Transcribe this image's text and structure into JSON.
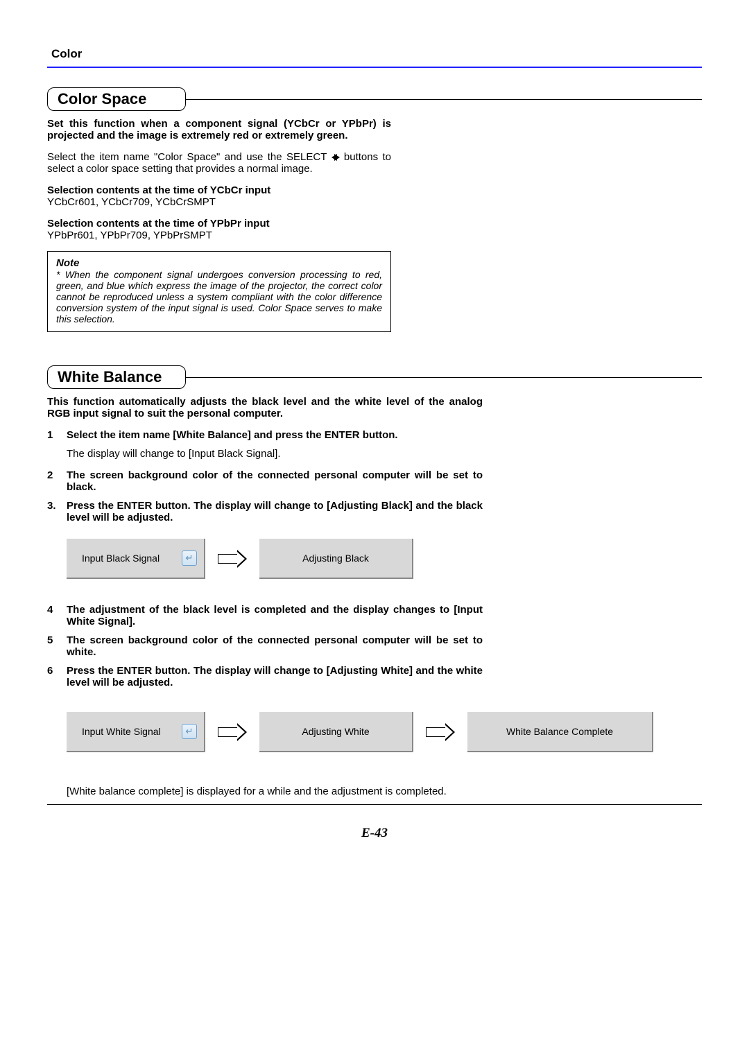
{
  "header": {
    "label": "Color"
  },
  "section1": {
    "title": "Color Space",
    "intro_bold": "Set this function when a component signal (YCbCr or YPbPr) is projected and the image is extremely red or extremely green.",
    "body_pre": "Select the item name \"Color Space\" and use the SELECT ",
    "body_post": " buttons to select a color space setting that provides a normal image.",
    "sub1_label": "Selection contents at the time of YCbCr input",
    "sub1_values": "YCbCr601, YCbCr709, YCbCrSMPT",
    "sub2_label": "Selection contents at the time of YPbPr input",
    "sub2_values": "YPbPr601, YPbPr709, YPbPrSMPT",
    "note_title": "Note",
    "note_body": "* When the component signal undergoes conversion processing to red, green, and blue which express the image of the projector, the correct color cannot be reproduced unless a system compliant with the color difference conversion system of the input signal is used. Color Space serves to make this selection."
  },
  "section2": {
    "title": "White Balance",
    "intro_bold": "This function automatically adjusts the black level and the white level of the analog RGB input signal to suit the personal computer.",
    "steps": [
      {
        "n": "1",
        "bold": "Select the item name [White Balance] and press the ENTER button.",
        "plain": "The display will change to [Input Black Signal]."
      },
      {
        "n": "2",
        "bold": "The screen background color of the connected personal computer will be set to black."
      },
      {
        "n": "3.",
        "bold": "Press the ENTER button. The display will change to [Adjusting Black] and the black level will be adjusted."
      },
      {
        "n": "4",
        "bold": "The adjustment of the black level is completed and the display changes to [Input White Signal]."
      },
      {
        "n": "5",
        "bold": "The screen background color of the connected personal computer will be set to white."
      },
      {
        "n": "6",
        "bold": "Press the ENTER button. The display will change to [Adjusting White] and the white level will be adjusted."
      }
    ],
    "diagram1": {
      "box1": "Input Black Signal",
      "box2": "Adjusting Black"
    },
    "diagram2": {
      "box1": "Input White Signal",
      "box2": "Adjusting White",
      "box3": "White Balance Complete"
    },
    "final": "[White balance complete] is displayed for a while and the adjustment is completed.",
    "enter_glyph": "↵"
  },
  "page_number": "E-43"
}
